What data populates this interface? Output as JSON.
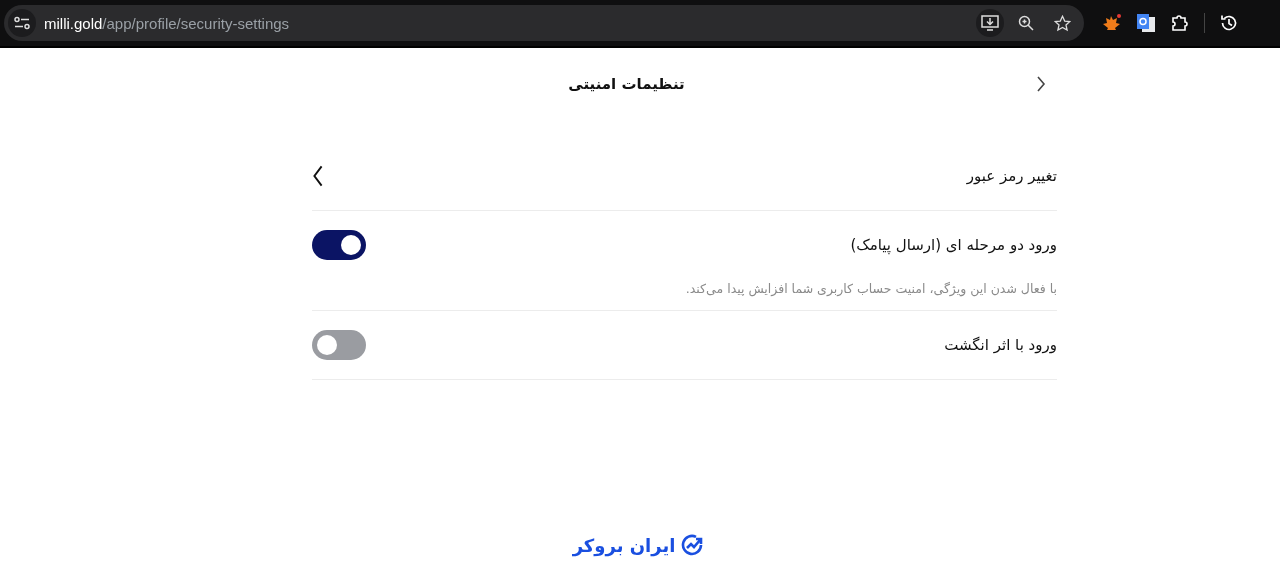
{
  "browser": {
    "url_host": "milli.gold",
    "url_path": "/app/profile/security-settings"
  },
  "header": {
    "title": "تنظیمات امنیتی"
  },
  "settings": [
    {
      "kind": "link",
      "label": "تغییر رمز عبور"
    },
    {
      "kind": "toggle",
      "label": "ورود دو مرحله ای (ارسال پیامک)",
      "on": true,
      "description": "با فعال شدن این ویژگی، امنیت حساب کاربری شما افزایش پیدا می‌کند."
    },
    {
      "kind": "toggle",
      "label": "ورود با اثر انگشت",
      "on": false
    }
  ],
  "footer": {
    "logo_text": "ایران بروکر"
  }
}
